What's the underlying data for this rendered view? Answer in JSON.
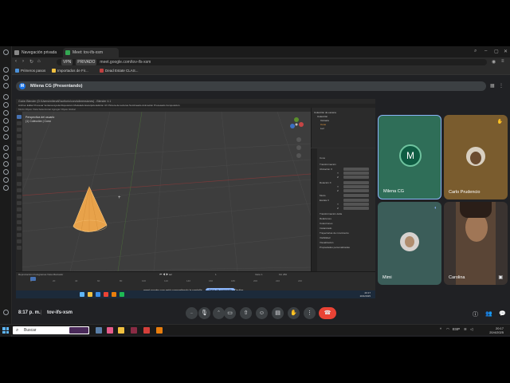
{
  "browser": {
    "tabs": [
      {
        "label": "Navegación privada"
      },
      {
        "label": "Meet: tov-ifs-xsm"
      }
    ],
    "url_pill": "VPN",
    "url_badge": "PRIVADO",
    "url": "meet.google.com/tov-ifs-xsm",
    "bookmarks": [
      {
        "label": "Primeros pasos"
      },
      {
        "label": "Importados de Fir..."
      },
      {
        "label": "Dead Estate CLAS..."
      }
    ]
  },
  "meet": {
    "presenter_initial": "M",
    "presenting_label": "Milena CG (Presentando)",
    "share_message": "meet.google.com está compartiendo la pantalla.",
    "stop_share": "Dejar de compartir",
    "hide": "Ocultar",
    "participants": [
      {
        "name": "Milena CG",
        "initial": "M"
      },
      {
        "name": "Carlo Prudencio"
      },
      {
        "name": "Mimi"
      },
      {
        "name": "Carolina"
      }
    ],
    "time": "8:17 p. m.",
    "separator": "|",
    "meeting_code": "tov-ifs-xsm",
    "controls": [
      "cc-icon",
      "mic-icon",
      "more-icon",
      "camera-icon",
      "present-icon",
      "emoji-icon",
      "captions-icon",
      "raise-hand-icon",
      "more-options-icon",
      "end-call-icon"
    ]
  },
  "blender": {
    "title": "Guión Blender (D:\\Users\\milena\\Escritorio\\cono\\dimensiones) - Blender 4.1",
    "menu": "Archivo  Editar  Procesar  Ventana  Ayuda    Disposición  Modelado  Esculpido  Edición UV  Pintura de texturas  Sombreado  Animación  Procesado  Composición",
    "viewport_header": "Modo Objeto   Vista   Seleccionar   Agregar   Objeto   Global",
    "viewport_info_1": "Perspectiva del usuario",
    "viewport_info_2": "(1) Colección | Cono",
    "outliner_rows": [
      "Colección de escena",
      "Colección",
      "Cámara",
      "Cono",
      "Luz"
    ],
    "props_rows": [
      "Cono",
      "Transformación",
      "Ubicación X",
      "Y",
      "Z",
      "Rotación X",
      "Y",
      "Z",
      "Modo",
      "Escala X",
      "Y",
      "Z",
      "Transformación delta",
      "Relaciones",
      "Colecciones",
      "Instanciado",
      "Trayectorias de movimiento",
      "Visibilidad",
      "Visualización",
      "Propiedades personalizadas"
    ],
    "timeline_label": "Reproducción   Fotogramas   Vista   Marcador",
    "ruler": [
      "0",
      "20",
      "40",
      "60",
      "80",
      "100",
      "120",
      "140",
      "160",
      "180",
      "200",
      "220",
      "240"
    ],
    "frame": "1",
    "start_label": "Inicio 1",
    "end_label": "Fin 250",
    "clock_time": "20:17",
    "clock_date": "20/4/2025"
  },
  "taskbar": {
    "search_placeholder": "Buscar",
    "lang": "ESP",
    "time": "20:17",
    "date": "20/4/2025"
  },
  "colors": {
    "meet_bg": "#202124",
    "active_tile": "#2f6e58",
    "end_call": "#ea4335",
    "accent": "#8ab4f8",
    "cone": "#e8a24a"
  }
}
